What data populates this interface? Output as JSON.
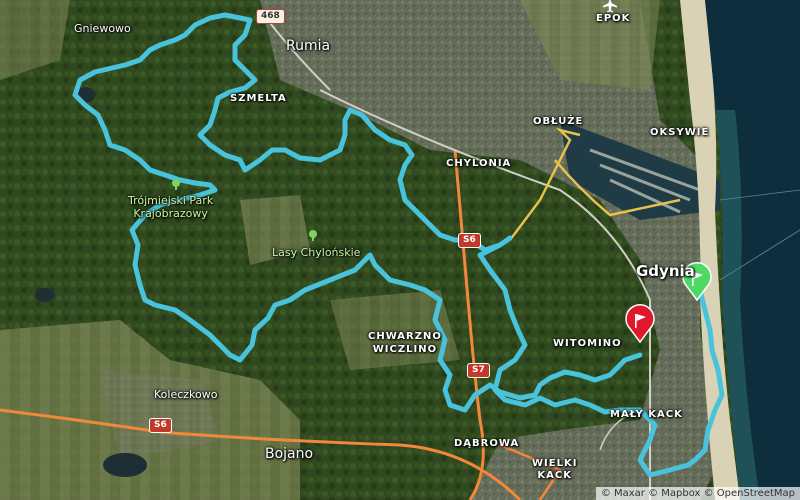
{
  "colors": {
    "route": "#49c3dc",
    "forest": "#2f4a22",
    "urban": "#6b6f66",
    "sea": "#0f2e3d",
    "highway": "#f2883a",
    "main_road": "#e7c24a",
    "start_flag": "#4cd964",
    "finish_flag": "#e0182d"
  },
  "places": {
    "gniewowo": "Gniewowo",
    "rumia": "Rumia",
    "szmelta": "SZMELTA",
    "oblUze": "OBŁUŻE",
    "oksywie": "OKSYWIE",
    "chylonia": "CHYLONIA",
    "epok": "EPOK",
    "gdynia": "Gdynia",
    "chwarzno": "CHWARZNO\nWICZLINO",
    "witomino": "WITOMINO",
    "koleczkowo": "Koleczkowo",
    "bojano": "Bojano",
    "dabrowa": "DĄBROWA",
    "wielki_kack": "WIELKI\nKACK",
    "maly_kack": "MAŁY KACK"
  },
  "parks": {
    "trojmiejski": "Trójmiejski Park\nKrajobrazowy",
    "lasy": "Lasy Chylońskie"
  },
  "roads": {
    "r468": "468",
    "s6": "S6",
    "s7": "S7",
    "s6_interchange": "S6"
  },
  "icons": {
    "start": "green-flag-icon",
    "finish": "red-flag-icon",
    "park": "tree-icon",
    "airport": "airplane-icon"
  },
  "attribution": "© Maxar © Mapbox © OpenStreetMap"
}
